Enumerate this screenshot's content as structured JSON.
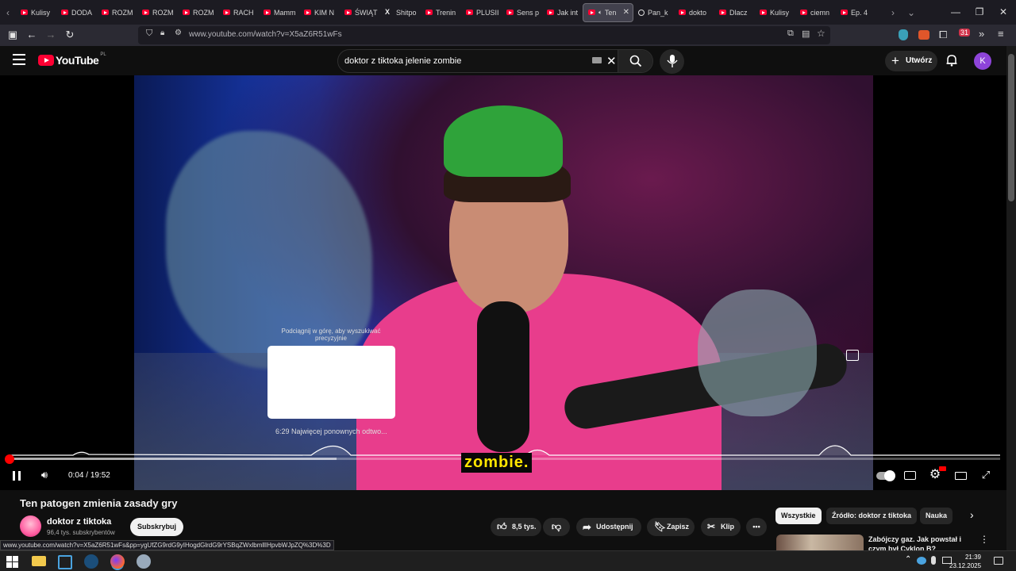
{
  "browser": {
    "tabs": [
      {
        "label": "Kulisy"
      },
      {
        "label": "DODA"
      },
      {
        "label": "ROZM"
      },
      {
        "label": "ROZM"
      },
      {
        "label": "ROZM"
      },
      {
        "label": "RACH"
      },
      {
        "label": "Mamm"
      },
      {
        "label": "KIM N"
      },
      {
        "label": "ŚWIĄT"
      },
      {
        "label": "Shitpo"
      },
      {
        "label": "Trenin"
      },
      {
        "label": "PLUSII"
      },
      {
        "label": "Sens p"
      },
      {
        "label": "Jak int"
      },
      {
        "label": "Ten",
        "active": true
      },
      {
        "label": "Pan_k"
      },
      {
        "label": "dokto"
      },
      {
        "label": "Dlacz"
      },
      {
        "label": "Kulisy"
      },
      {
        "label": "ciemn"
      },
      {
        "label": "Ep. 4"
      }
    ],
    "url": "www.youtube.com/watch?v=X5aZ6R51wFs",
    "status_url": "www.youtube.com/watch?v=X5aZ6R51wFs&pp=ygUfZG9rdG9yIHogdGlrdG9rYSBqZWxlbmllIHpvbWJpZQ%3D%3D",
    "extension_badge": "31"
  },
  "youtube": {
    "logo_text": "YouTube",
    "region": "PL",
    "search_query": "doktor z tiktoka jelenie zombie",
    "create_label": "Utwórz",
    "avatar_letter": "K"
  },
  "player": {
    "subtitle": "zombie.",
    "hint": "Podciągnij w górę, aby wyszukiwać precyzyjnie",
    "chapter": "6:29  Najwięcej ponownych odtwo...",
    "time_current": "0:04",
    "time_separator": " / ",
    "time_total": "19:52",
    "progress_played": 0.003,
    "progress_buffered": 0.33
  },
  "video": {
    "title": "Ten patogen zmienia zasady gry",
    "channel": "doktor z tiktoka",
    "subscribers": "96,4 tys. subskrybentów",
    "subscribe_label": "Subskrybuj",
    "likes": "8,5 tys.",
    "share_label": "Udostępnij",
    "save_label": "Zapisz",
    "clip_label": "Klip"
  },
  "related": {
    "chips": [
      "Wszystkie",
      "Źródło: doktor z tiktoka",
      "Nauka"
    ],
    "first_title": "Zabójczy gaz. Jak powstał i czym był Cyklon B?"
  },
  "taskbar": {
    "time": "21:39",
    "date": "23.12.2025"
  },
  "colors": {
    "youtube_red": "#ff0033",
    "subtitle_yellow": "#ffe600",
    "avatar_purple": "#8e44d9"
  }
}
